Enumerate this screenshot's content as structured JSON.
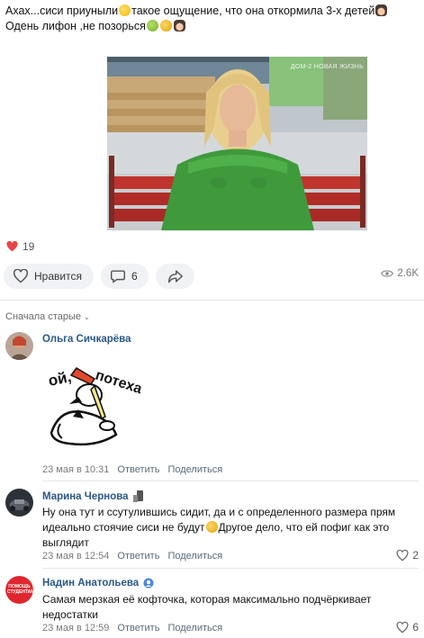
{
  "post": {
    "text_line1_a": "Ахах...сиси приуныли",
    "text_line1_b": "такое ощущение, что она откормила 3-х детей",
    "text_line2": "Одень лифон ,не позорься",
    "photo_watermark": "ДОМ-2 НОВАЯ ЖИЗНЬ",
    "reactions_count": "19"
  },
  "actions": {
    "like_label": "Нравится",
    "comment_count": "6",
    "views": "2.6K"
  },
  "sort_label": "Сначала старые",
  "comments": [
    {
      "author": "Ольга Сичкарёва",
      "sticker_text": "ой, потеха",
      "date": "23 мая в 10:31",
      "reply": "Ответить",
      "share": "Поделиться"
    },
    {
      "author": "Марина Чернова",
      "text_a": "Ну она тут и ссутулившись сидит, да и с определенного размера прям идеально стоячие сиси не будут",
      "text_b": "Другое дело, что ей пофиг как это выглядит",
      "date": "23 мая в 12:54",
      "reply": "Ответить",
      "share": "Поделиться",
      "likes": "2"
    },
    {
      "author": "Надин Анатольева",
      "avatar_text": "ПОМОЩЬ СТУДЕНТАМ",
      "text": "Самая мерзкая её кофточка, которая максимально подчёркивает недостатки",
      "date": "23 мая в 12:59",
      "reply": "Ответить",
      "share": "Поделиться",
      "likes": "6"
    }
  ],
  "colors": {
    "link": "#2a5885",
    "heart": "#e64646",
    "button_bg": "#f0f2f5"
  }
}
